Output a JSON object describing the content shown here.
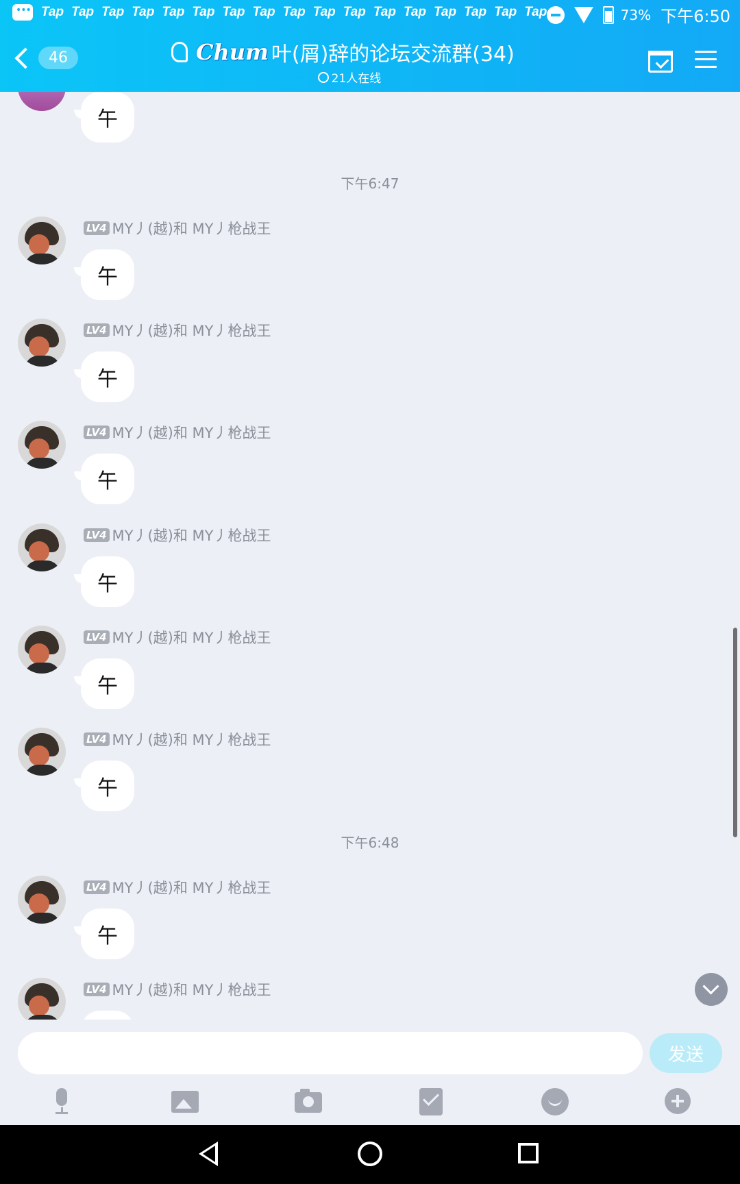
{
  "status_bar": {
    "tap_labels": [
      "Tap",
      "Tap",
      "Tap",
      "Tap",
      "Tap",
      "Tap",
      "Tap",
      "Tap",
      "Tap",
      "Tap",
      "Tap",
      "Tap",
      "Tap",
      "Tap",
      "Tap",
      "Tap",
      "Tap"
    ],
    "battery": "73%",
    "time": "下午6:50"
  },
  "header": {
    "unread_count": "46",
    "logo_text": "Chum",
    "title": "叶(屑)辞的论坛交流群(34)",
    "online": "21人在线"
  },
  "chat": {
    "first_bubble": "午",
    "separators": [
      "下午6:47",
      "下午6:48"
    ],
    "messages": [
      {
        "level": "LV4",
        "sender": "MY丿(越)和 MY丿枪战王",
        "text": "午"
      },
      {
        "level": "LV4",
        "sender": "MY丿(越)和 MY丿枪战王",
        "text": "午"
      },
      {
        "level": "LV4",
        "sender": "MY丿(越)和 MY丿枪战王",
        "text": "午"
      },
      {
        "level": "LV4",
        "sender": "MY丿(越)和 MY丿枪战王",
        "text": "午"
      },
      {
        "level": "LV4",
        "sender": "MY丿(越)和 MY丿枪战王",
        "text": "午"
      },
      {
        "level": "LV4",
        "sender": "MY丿(越)和 MY丿枪战王",
        "text": "午"
      },
      {
        "level": "LV4",
        "sender": "MY丿(越)和 MY丿枪战王",
        "text": "午"
      },
      {
        "level": "LV4",
        "sender": "MY丿(越)和 MY丿枪战王",
        "text": ""
      }
    ]
  },
  "input": {
    "placeholder": "",
    "send_label": "发送"
  },
  "toolbar_icons": [
    "microphone-icon",
    "image-icon",
    "camera-icon",
    "red-packet-icon",
    "emoji-icon",
    "plus-icon"
  ],
  "colors": {
    "header_start": "#0bc5f7",
    "header_end": "#13a9f6",
    "chat_bg": "#eceff5",
    "send_button": "#b9ecf8"
  }
}
